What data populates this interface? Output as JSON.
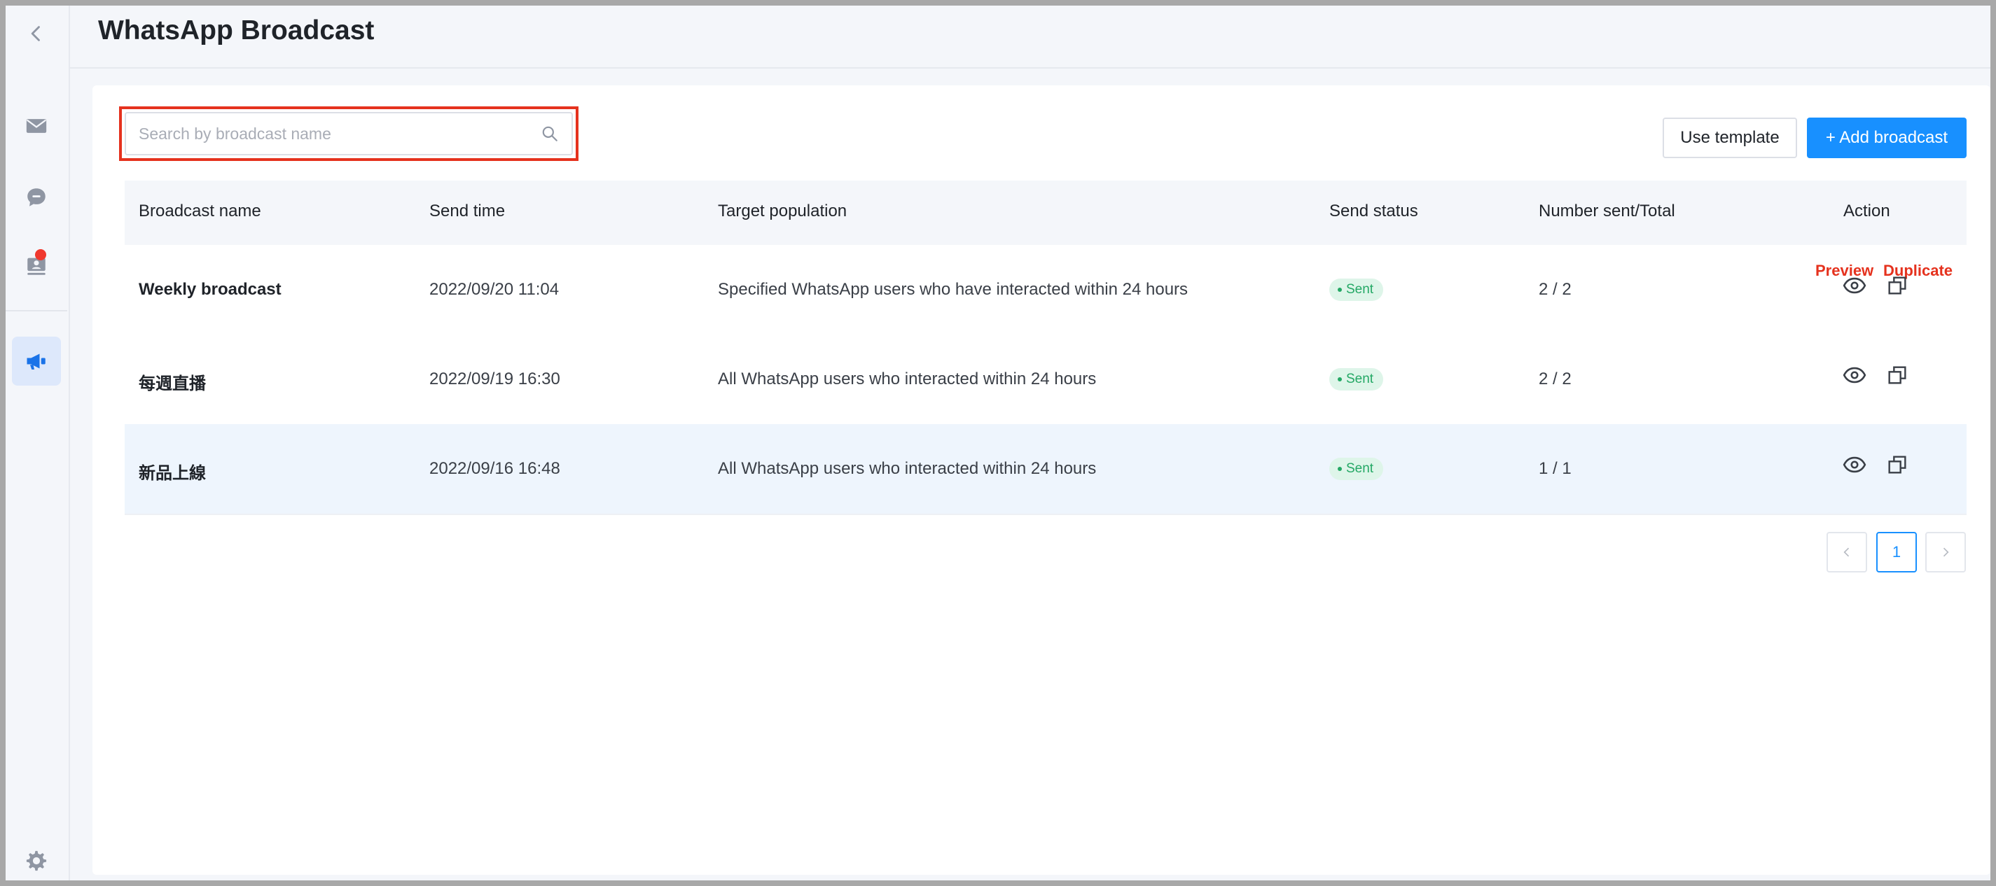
{
  "header": {
    "title": "WhatsApp Broadcast"
  },
  "sidebar": {
    "items": [
      {
        "name": "back",
        "icon": "chevron-left-icon"
      },
      {
        "name": "inbox",
        "icon": "mail-icon"
      },
      {
        "name": "chat",
        "icon": "chat-bubble-icon"
      },
      {
        "name": "contacts",
        "icon": "contact-card-icon",
        "has_notification": true
      },
      {
        "name": "broadcast",
        "icon": "megaphone-icon",
        "active": true
      },
      {
        "name": "settings",
        "icon": "gear-icon"
      }
    ]
  },
  "toolbar": {
    "search_placeholder": "Search by broadcast name",
    "search_value": "",
    "use_template_label": "Use template",
    "add_broadcast_label": "+ Add broadcast"
  },
  "table": {
    "columns": [
      "Broadcast name",
      "Send time",
      "Target population",
      "Send status",
      "Number sent/Total",
      "Action"
    ],
    "rows": [
      {
        "name": "Weekly broadcast",
        "send_time": "2022/09/20 11:04",
        "target": "Specified WhatsApp users who have interacted within 24 hours",
        "status": "Sent",
        "count": "2 / 2"
      },
      {
        "name": "每週直播",
        "send_time": "2022/09/19 16:30",
        "target": "All WhatsApp users who interacted within 24 hours",
        "status": "Sent",
        "count": "2 / 2"
      },
      {
        "name": "新品上線",
        "send_time": "2022/09/16 16:48",
        "target": "All WhatsApp users who interacted within 24 hours",
        "status": "Sent",
        "count": "1 / 1"
      }
    ],
    "annotations": {
      "preview": "Preview",
      "duplicate": "Duplicate"
    }
  },
  "pagination": {
    "current_page": "1",
    "prev_icon": "chevron-left-icon",
    "next_icon": "chevron-right-icon"
  },
  "colors": {
    "primary": "#1890ff",
    "status_sent_text": "#24a865",
    "status_sent_bg": "#def5e9",
    "annotation_red": "#e5321e",
    "notification_dot": "#f0382e"
  }
}
